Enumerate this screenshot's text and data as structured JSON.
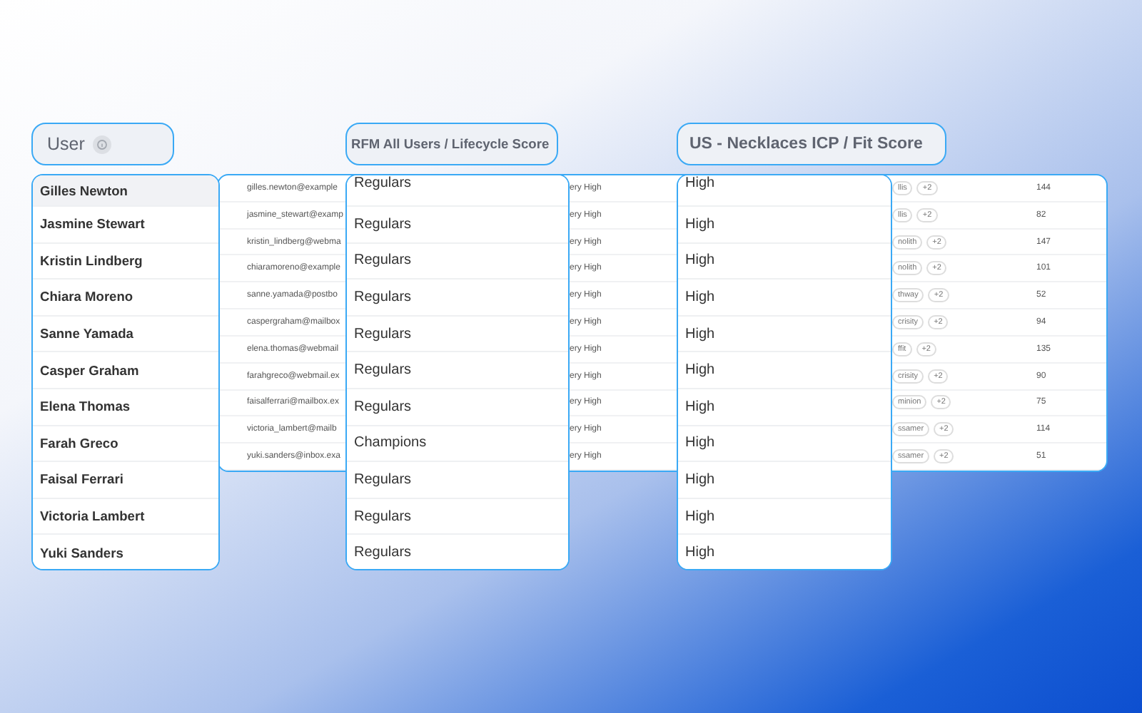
{
  "background_table": {
    "rows": [
      {
        "email": "gilles.newton@example",
        "column_2": "ery High",
        "tags": [
          "llis",
          "+2"
        ],
        "column_4": "144"
      },
      {
        "email": "jasmine_stewart@examp",
        "column_2": "ery High",
        "tags": [
          "llis",
          "+2"
        ],
        "column_4": "82"
      },
      {
        "email": "kristin_lindberg@webma",
        "column_2": "ery High",
        "tags": [
          "nolith",
          "+2"
        ],
        "column_4": "147"
      },
      {
        "email": "chiaramoreno@example",
        "column_2": "ery High",
        "tags": [
          "nolith",
          "+2"
        ],
        "column_4": "101"
      },
      {
        "email": "sanne.yamada@postbo",
        "column_2": "ery High",
        "tags": [
          "thway",
          "+2"
        ],
        "column_4": "52"
      },
      {
        "email": "caspergraham@mailbox",
        "column_2": "ery High",
        "tags": [
          "crisity",
          "+2"
        ],
        "column_4": "94"
      },
      {
        "email": "elena.thomas@webmail",
        "column_2": "ery High",
        "tags": [
          "ffit",
          "+2"
        ],
        "column_4": "135"
      },
      {
        "email": "farahgreco@webmail.ex",
        "column_2": "ery High",
        "tags": [
          "crisity",
          "+2"
        ],
        "column_4": "90"
      },
      {
        "email": "faisalferrari@mailbox.ex",
        "column_2": "ery High",
        "tags": [
          "minion",
          "+2"
        ],
        "column_4": "75"
      },
      {
        "email": "victoria_lambert@mailb",
        "column_2": "ery High",
        "tags": [
          "ssamer",
          "+2"
        ],
        "column_4": "114"
      },
      {
        "email": "yuki.sanders@inbox.exa",
        "column_2": "ery High",
        "tags": [
          "ssamer",
          "+2"
        ],
        "column_4": "51"
      }
    ]
  },
  "user_column": {
    "header": "User",
    "rows": [
      {
        "name": "Gilles Newton",
        "selected": true
      },
      {
        "name": "Jasmine Stewart",
        "selected": false
      },
      {
        "name": "Kristin Lindberg",
        "selected": false
      },
      {
        "name": "Chiara Moreno",
        "selected": false
      },
      {
        "name": "Sanne Yamada",
        "selected": false
      },
      {
        "name": "Casper Graham",
        "selected": false
      },
      {
        "name": "Elena Thomas",
        "selected": false
      },
      {
        "name": "Farah Greco",
        "selected": false
      },
      {
        "name": "Faisal Ferrari",
        "selected": false
      },
      {
        "name": "Victoria Lambert",
        "selected": false
      },
      {
        "name": "Yuki Sanders",
        "selected": false
      }
    ]
  },
  "lifecycle_column": {
    "header": "RFM All Users / Lifecycle Score",
    "rows": [
      "Regulars",
      "Regulars",
      "Regulars",
      "Regulars",
      "Regulars",
      "Regulars",
      "Regulars",
      "Champions",
      "Regulars",
      "Regulars",
      "Regulars"
    ]
  },
  "fit_column": {
    "header": "US - Necklaces ICP / Fit Score",
    "rows": [
      "High",
      "High",
      "High",
      "High",
      "High",
      "High",
      "High",
      "High",
      "High",
      "High",
      "High"
    ]
  }
}
